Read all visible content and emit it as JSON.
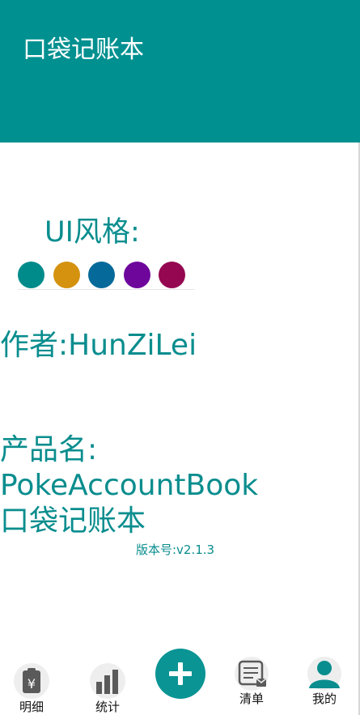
{
  "app_bar": {
    "title": "口袋记账本",
    "color": "#009090"
  },
  "ui_style": {
    "label": "UI风格:",
    "swatches": [
      {
        "color": "#008B8B"
      },
      {
        "color": "#D4920E"
      },
      {
        "color": "#056A9A"
      },
      {
        "color": "#6E069C"
      },
      {
        "color": "#950851"
      }
    ]
  },
  "author": {
    "line": "作者:HunZiLei"
  },
  "product": {
    "label": "产品名:",
    "name_en": "PokeAccountBook",
    "name_cn": "口袋记账本"
  },
  "version": {
    "text": "版本号:v2.1.3"
  },
  "bottom_nav": {
    "items": [
      {
        "label": "明细",
        "icon": "receipt-yuan-icon"
      },
      {
        "label": "统计",
        "icon": "bar-chart-icon"
      },
      {
        "label": "",
        "icon": "plus-icon"
      },
      {
        "label": "清单",
        "icon": "list-icon"
      },
      {
        "label": "我的",
        "icon": "user-icon"
      }
    ]
  },
  "colors": {
    "accent_text": "#0a8d8e",
    "fab": "#0a9494"
  }
}
